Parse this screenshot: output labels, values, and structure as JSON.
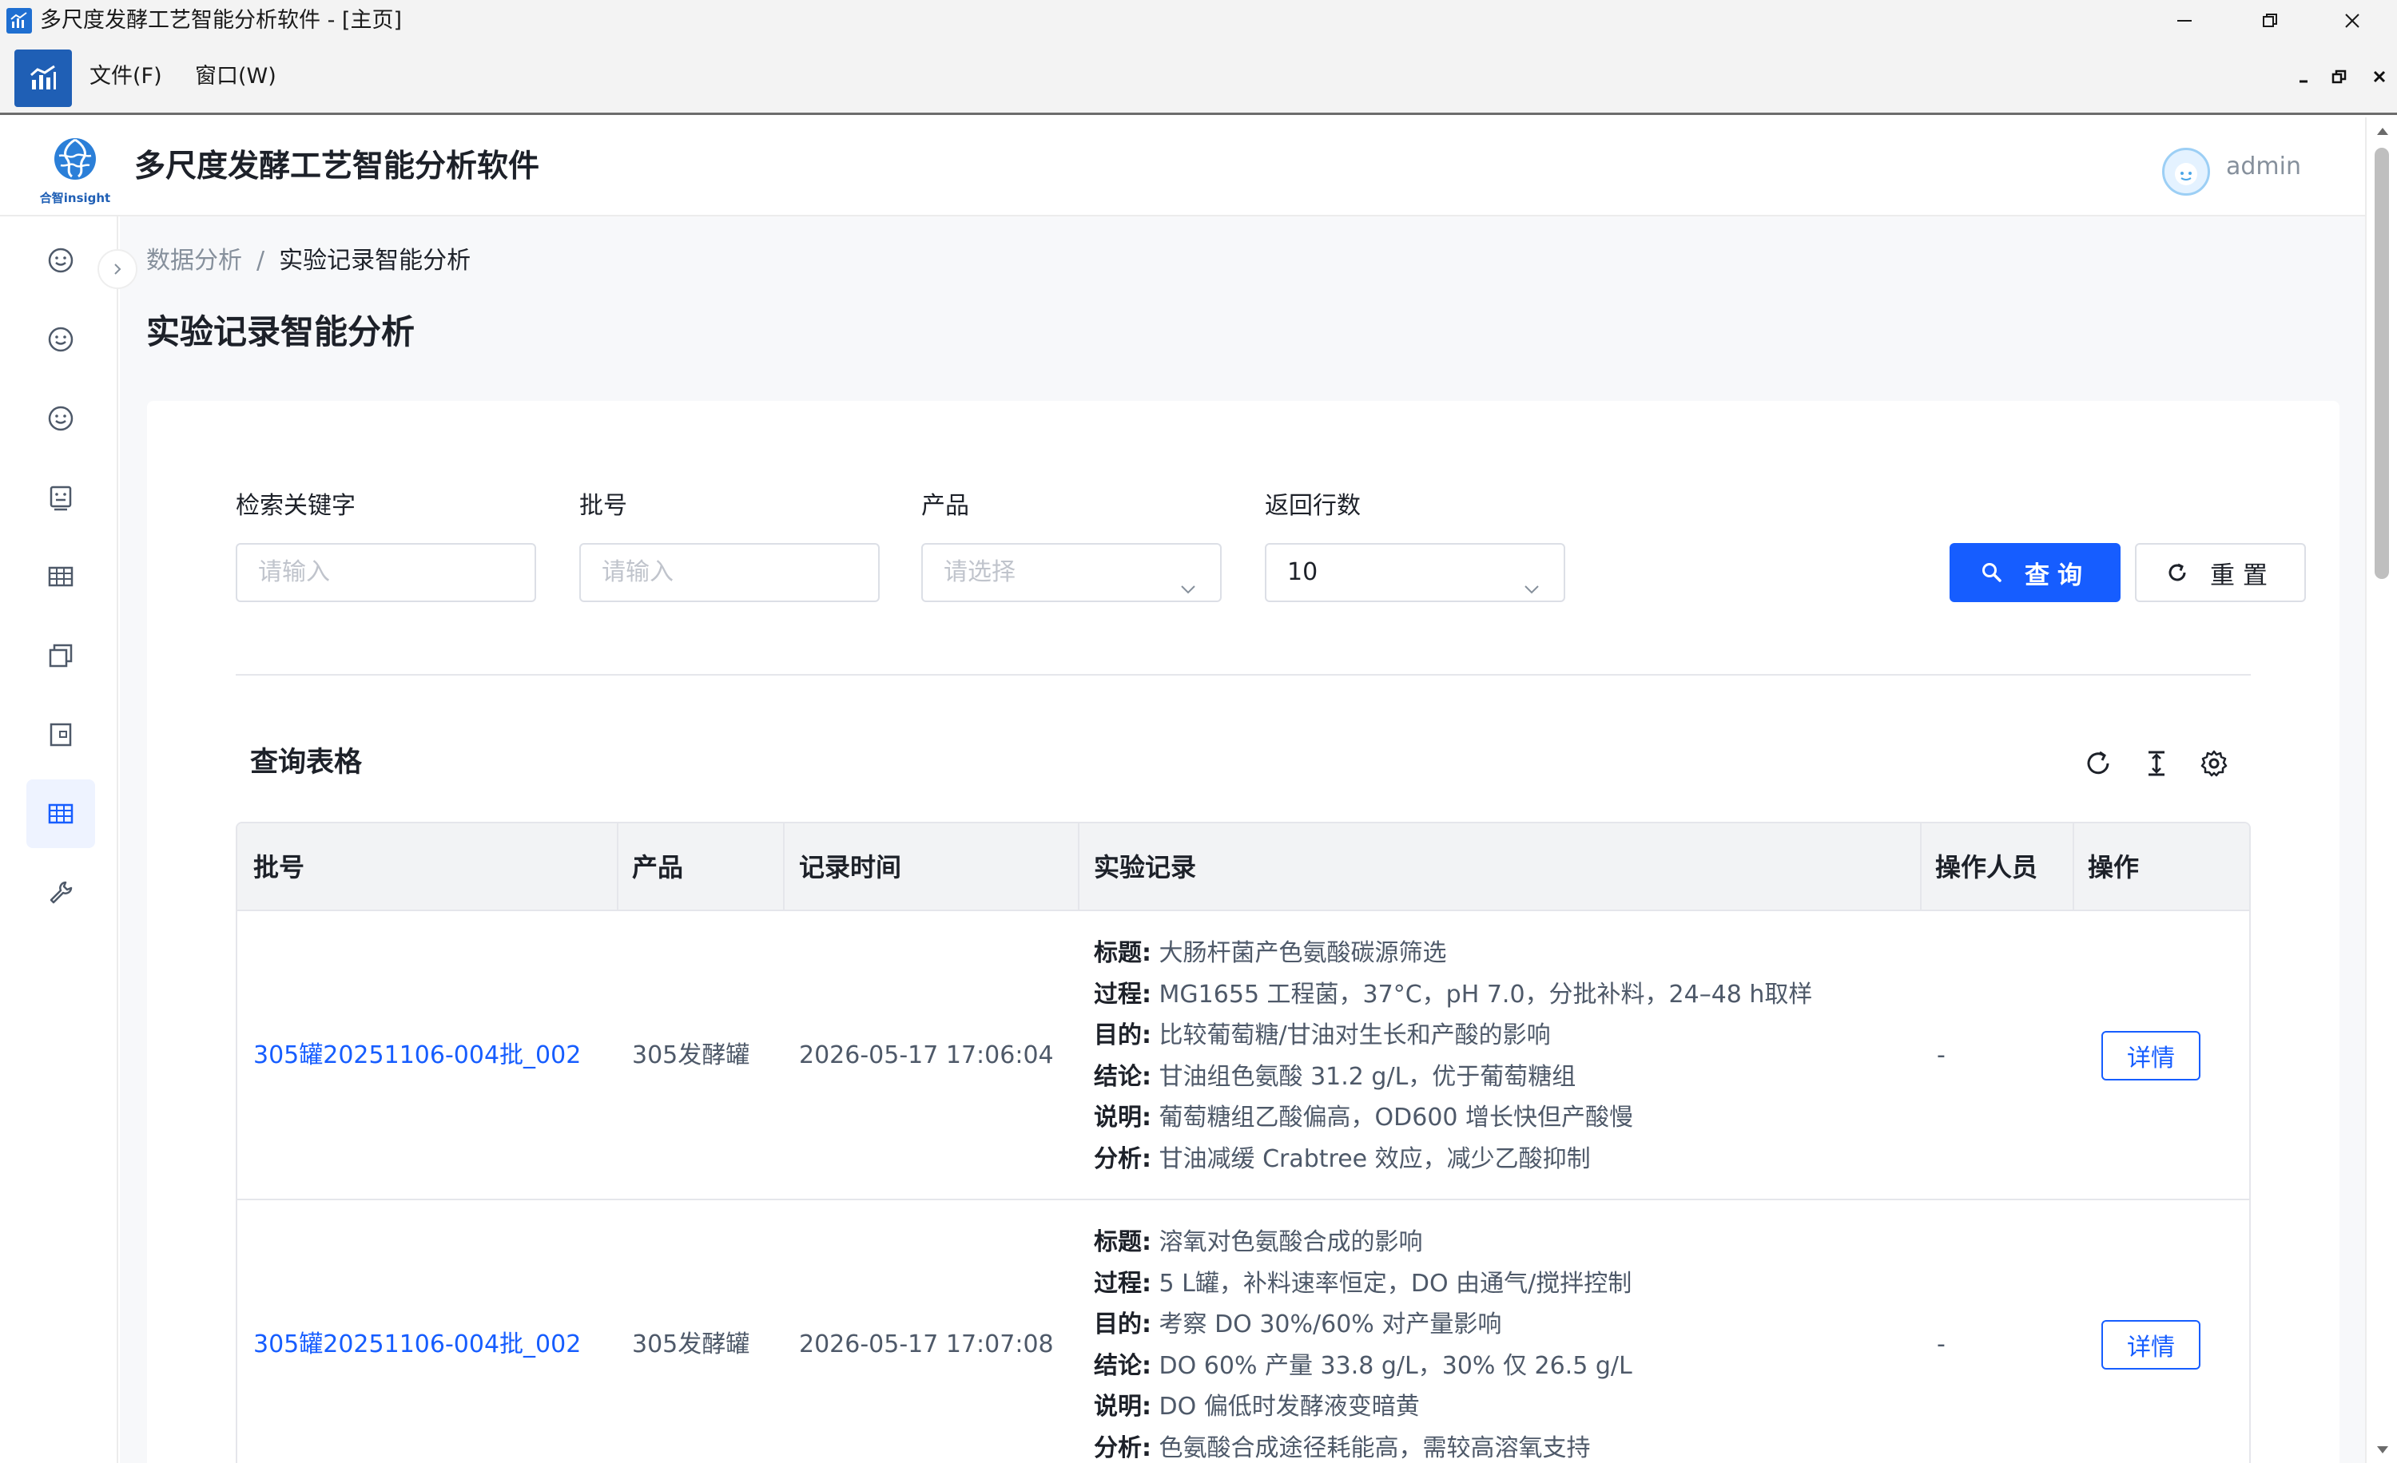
{
  "window": {
    "title": "多尺度发酵工艺智能分析软件 - [主页]"
  },
  "menubar": {
    "items": [
      "文件(F)",
      "窗口(W)"
    ]
  },
  "header": {
    "brand_title": "多尺度发酵工艺智能分析软件",
    "logo_caption": "合智insight",
    "username": "admin"
  },
  "sidebar": {
    "items": [
      {
        "icon": "smile-icon"
      },
      {
        "icon": "smile-icon"
      },
      {
        "icon": "smile-icon"
      },
      {
        "icon": "monitor-face-icon"
      },
      {
        "icon": "table-icon"
      },
      {
        "icon": "copy-icon"
      },
      {
        "icon": "tablet-icon"
      },
      {
        "icon": "table-icon",
        "active": true
      },
      {
        "icon": "wrench-icon"
      }
    ]
  },
  "breadcrumb": {
    "parent": "数据分析",
    "separator": "/",
    "current": "实验记录智能分析"
  },
  "page_title": "实验记录智能分析",
  "search_form": {
    "keyword": {
      "label": "检索关键字",
      "placeholder": "请输入"
    },
    "batch": {
      "label": "批号",
      "placeholder": "请输入"
    },
    "product": {
      "label": "产品",
      "placeholder": "请选择"
    },
    "rows": {
      "label": "返回行数",
      "value": "10"
    },
    "query_label": "查询",
    "reset_label": "重置"
  },
  "table_section": {
    "title": "查询表格"
  },
  "table": {
    "columns": [
      "批号",
      "产品",
      "记录时间",
      "实验记录",
      "操作人员",
      "操作"
    ],
    "rows": [
      {
        "batch": "305罐20251106-004批_002",
        "product": "305发酵罐",
        "time": "2026-05-17 17:06:04",
        "record": [
          {
            "key": "标题:",
            "value": "大肠杆菌产色氨酸碳源筛选"
          },
          {
            "key": "过程:",
            "value": "MG1655 工程菌，37°C，pH 7.0，分批补料，24–48 h取样"
          },
          {
            "key": "目的:",
            "value": "比较葡萄糖/甘油对生长和产酸的影响"
          },
          {
            "key": "结论:",
            "value": "甘油组色氨酸 31.2 g/L，优于葡萄糖组"
          },
          {
            "key": "说明:",
            "value": "葡萄糖组乙酸偏高，OD600 增长快但产酸慢"
          },
          {
            "key": "分析:",
            "value": "甘油减缓 Crabtree 效应，减少乙酸抑制"
          }
        ],
        "operator": "-",
        "action": "详情"
      },
      {
        "batch": "305罐20251106-004批_002",
        "product": "305发酵罐",
        "time": "2026-05-17 17:07:08",
        "record": [
          {
            "key": "标题:",
            "value": "溶氧对色氨酸合成的影响"
          },
          {
            "key": "过程:",
            "value": "5 L罐，补料速率恒定，DO 由通气/搅拌控制"
          },
          {
            "key": "目的:",
            "value": "考察 DO 30%/60% 对产量影响"
          },
          {
            "key": "结论:",
            "value": "DO 60% 产量 33.8 g/L，30% 仅 26.5 g/L"
          },
          {
            "key": "说明:",
            "value": "DO 偏低时发酵液变暗黄"
          },
          {
            "key": "分析:",
            "value": "色氨酸合成途径耗能高，需较高溶氧支持"
          }
        ],
        "operator": "-",
        "action": "详情"
      }
    ]
  },
  "colors": {
    "primary": "#165dff",
    "sidebar_active_bg": "#eef3ff",
    "header_bg": "#f2f3f5",
    "page_bg": "#f7f8fa"
  }
}
